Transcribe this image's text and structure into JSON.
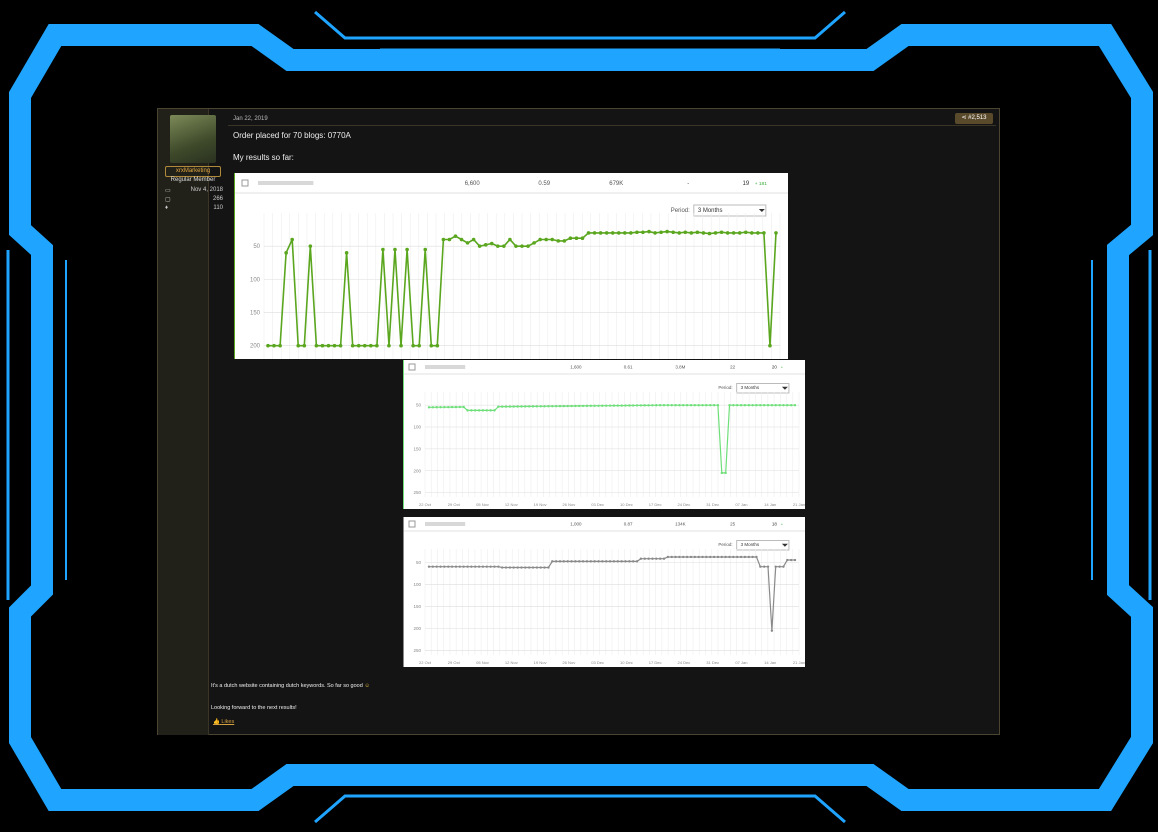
{
  "post": {
    "date": "Jan 22, 2019",
    "post_number": "#2,513",
    "text_line1": "Order placed for 70 blogs: 0770A",
    "text_line2": "My results so far:",
    "text_line3": "It's a dutch website containing dutch keywords. So far so good",
    "text_line4": "Looking forward to the next results!",
    "like_label": "Likes"
  },
  "user": {
    "name": "xrxMarketing",
    "role": "Regular Member",
    "joined": "Nov 4, 2018",
    "messages": "266",
    "reactions": "110",
    "icons": [
      "calendar-icon",
      "messages-icon",
      "thumbs-up-icon"
    ]
  },
  "colors": {
    "accent_frame": "#1fa4ff",
    "post_border": "#4a4430",
    "series1": "#5aa61e",
    "series2": "#6fdf7a",
    "series3": "#8a8a8a"
  },
  "charts": [
    {
      "row": {
        "v1": "6,600",
        "v2": "0.59",
        "v3": "679K",
        "v4": "-",
        "rank": "19",
        "delta": "+ 181"
      },
      "period_label": "Period:",
      "period_value": "3 Months",
      "y_ticks": [
        "50",
        "100",
        "150",
        "200"
      ],
      "x_ticks": []
    },
    {
      "row": {
        "v1": "1,600",
        "v2": "0.61",
        "v3": "3.8M",
        "v4": "22",
        "rank": "20",
        "delta": "+"
      },
      "period_label": "Period:",
      "period_value": "3 Months",
      "y_ticks": [
        "50",
        "100",
        "150",
        "200",
        "250"
      ],
      "x_ticks": [
        "22 Oct",
        "29 Oct",
        "05 Nov",
        "12 Nov",
        "19 Nov",
        "26 Nov",
        "03 Dec",
        "10 Dec",
        "17 Dec",
        "24 Dec",
        "31 Dec",
        "07 Jan",
        "14 Jan",
        "21 Jan"
      ]
    },
    {
      "row": {
        "v1": "1,000",
        "v2": "0.87",
        "v3": "134K",
        "v4": "25",
        "rank": "18",
        "delta": "+"
      },
      "period_label": "Period:",
      "period_value": "3 Months",
      "y_ticks": [
        "50",
        "100",
        "150",
        "200",
        "250"
      ],
      "x_ticks": [
        "22 Oct",
        "29 Oct",
        "05 Nov",
        "12 Nov",
        "19 Nov",
        "26 Nov",
        "03 Dec",
        "10 Dec",
        "17 Dec",
        "24 Dec",
        "31 Dec",
        "07 Jan",
        "14 Jan",
        "21 Jan"
      ]
    }
  ]
}
